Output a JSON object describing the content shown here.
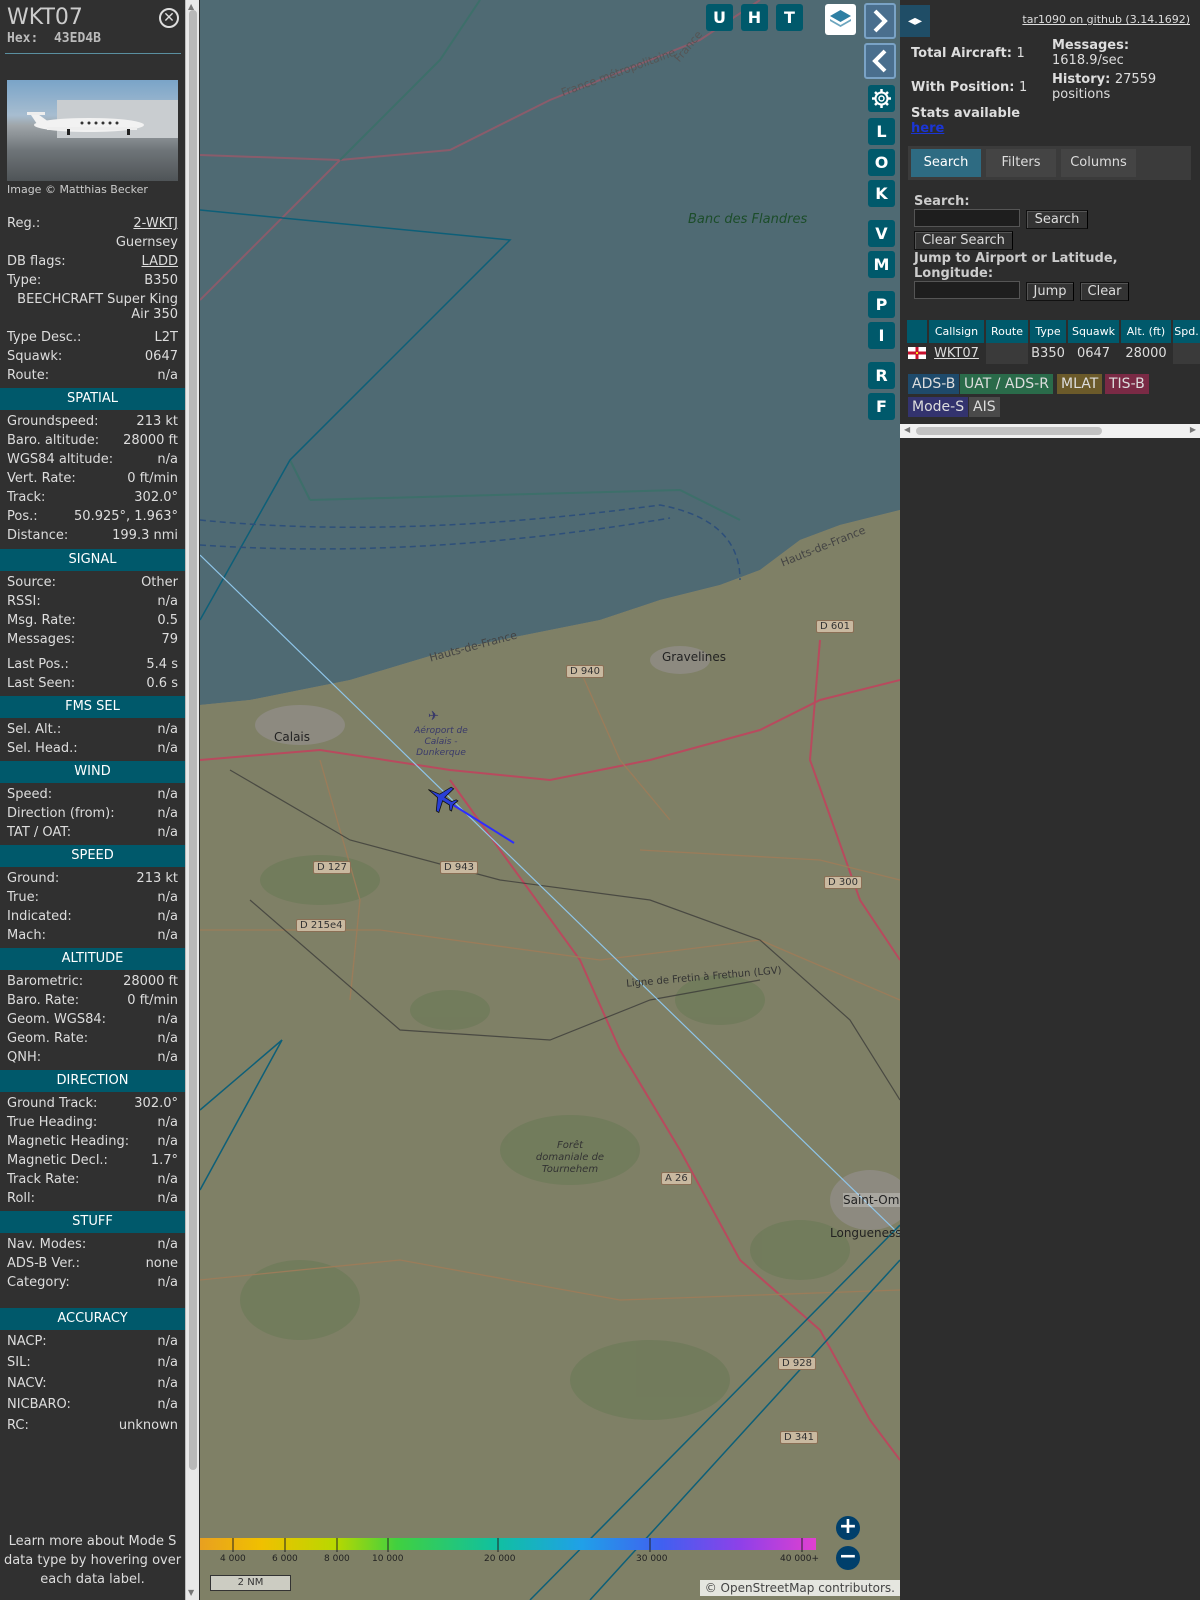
{
  "aircraft": {
    "callsign": "WKT07",
    "hex_label": "Hex:",
    "hex": "43ED4B",
    "image_credit": "Image © Matthias Becker"
  },
  "details": [
    {
      "k": "Reg.:",
      "v": "2-WKTJ",
      "underline": true
    },
    {
      "k": "",
      "v": "Guernsey"
    },
    {
      "k": "DB flags:",
      "v": "LADD",
      "underline": true
    },
    {
      "k": "Type:",
      "v": "B350"
    }
  ],
  "type_full": "BEECHCRAFT Super King Air 350",
  "details2": [
    {
      "k": "Type Desc.:",
      "v": "L2T"
    },
    {
      "k": "Squawk:",
      "v": "0647"
    },
    {
      "k": "Route:",
      "v": "n/a"
    }
  ],
  "sections": [
    {
      "title": "SPATIAL",
      "rows": [
        {
          "k": "Groundspeed:",
          "v": "213 kt"
        },
        {
          "k": "Baro. altitude:",
          "v": "28000 ft"
        },
        {
          "k": "WGS84 altitude:",
          "v": "n/a"
        },
        {
          "k": "Vert. Rate:",
          "v": "0 ft/min"
        },
        {
          "k": "Track:",
          "v": "302.0°"
        },
        {
          "k": "Pos.:",
          "v": "50.925°, 1.963°"
        },
        {
          "k": "Distance:",
          "v": "199.3 nmi"
        }
      ]
    },
    {
      "title": "SIGNAL",
      "rows": [
        {
          "k": "Source:",
          "v": "Other"
        },
        {
          "k": "RSSI:",
          "v": "n/a"
        },
        {
          "k": "Msg. Rate:",
          "v": "0.5"
        },
        {
          "k": "Messages:",
          "v": "79"
        },
        {
          "k": "Last Pos.:",
          "v": "5.4 s"
        },
        {
          "k": "Last Seen:",
          "v": "0.6 s"
        }
      ]
    },
    {
      "title": "FMS SEL",
      "rows": [
        {
          "k": "Sel. Alt.:",
          "v": "n/a"
        },
        {
          "k": "Sel. Head.:",
          "v": "n/a"
        }
      ]
    },
    {
      "title": "WIND",
      "rows": [
        {
          "k": "Speed:",
          "v": "n/a"
        },
        {
          "k": "Direction (from):",
          "v": "n/a"
        },
        {
          "k": "TAT / OAT:",
          "v": "n/a"
        }
      ]
    },
    {
      "title": "SPEED",
      "rows": [
        {
          "k": "Ground:",
          "v": "213 kt"
        },
        {
          "k": "True:",
          "v": "n/a"
        },
        {
          "k": "Indicated:",
          "v": "n/a"
        },
        {
          "k": "Mach:",
          "v": "n/a"
        }
      ]
    },
    {
      "title": "ALTITUDE",
      "rows": [
        {
          "k": "Barometric:",
          "v": "28000 ft"
        },
        {
          "k": "Baro. Rate:",
          "v": "0 ft/min"
        },
        {
          "k": "Geom. WGS84:",
          "v": "n/a"
        },
        {
          "k": "Geom. Rate:",
          "v": "n/a"
        },
        {
          "k": "QNH:",
          "v": "n/a"
        }
      ]
    },
    {
      "title": "DIRECTION",
      "rows": [
        {
          "k": "Ground Track:",
          "v": "302.0°"
        },
        {
          "k": "True Heading:",
          "v": "n/a"
        },
        {
          "k": "Magnetic Heading:",
          "v": "n/a"
        },
        {
          "k": "Magnetic Decl.:",
          "v": "1.7°"
        },
        {
          "k": "Track Rate:",
          "v": "n/a"
        },
        {
          "k": "Roll:",
          "v": "n/a"
        }
      ]
    },
    {
      "title": "STUFF",
      "rows": [
        {
          "k": "Nav. Modes:",
          "v": "n/a"
        },
        {
          "k": "ADS-B Ver.:",
          "v": "none"
        },
        {
          "k": "Category:",
          "v": "n/a"
        }
      ]
    },
    {
      "title": "ACCURACY",
      "rows": [
        {
          "k": "NACP:",
          "v": "n/a"
        },
        {
          "k": "SIL:",
          "v": "n/a"
        },
        {
          "k": "NACV:",
          "v": "n/a"
        },
        {
          "k": "NICBARO:",
          "v": "n/a"
        },
        {
          "k": "RC:",
          "v": "unknown"
        }
      ]
    }
  ],
  "learn_more": "Learn more about Mode S data type by hovering over each data label.",
  "map": {
    "top_buttons": [
      "U",
      "H",
      "T"
    ],
    "side_buttons": [
      "L",
      "O",
      "K",
      "V",
      "M",
      "P",
      "I",
      "R",
      "F"
    ],
    "settings_icon": "gear-icon",
    "layers_icon": "layers-icon",
    "labels": {
      "banc": "Banc des Flandres",
      "gravelines": "Gravelines",
      "calais": "Calais",
      "aeroport": "Aéroport de Calais - Dunkerque",
      "france_metro": "France métropolitaine",
      "france": "France",
      "hauts1": "Hauts-de-France",
      "hauts2": "Hauts-de-France",
      "saint_omer": "Saint-Omer",
      "longuenesse": "Longuenesse",
      "foret": "Forêt domaniale de Tournehem",
      "ligne": "Ligne de Fretin à Frethun (LGV)"
    },
    "road_tags": [
      "D 940",
      "D 601",
      "D 127",
      "D 943",
      "D 300",
      "D 215e4",
      "A 26",
      "D 928",
      "D 341"
    ],
    "colorbar_labels": [
      "4 000",
      "6 000",
      "8 000",
      "10 000",
      "20 000",
      "30 000",
      "40 000+"
    ],
    "scale": "2 NM",
    "attribution": "© OpenStreetMap contributors."
  },
  "right": {
    "github": "tar1090 on github (3.14.1692)",
    "total_aircraft_label": "Total Aircraft:",
    "total_aircraft": "1",
    "with_position_label": "With Position:",
    "with_position": "1",
    "messages_label": "Messages:",
    "messages_value": "1618.9/sec",
    "history_label": "History:",
    "history_value": "27559",
    "history_unit": "positions",
    "stats_label": "Stats available",
    "stats_link": "here",
    "tabs": [
      "Search",
      "Filters",
      "Columns"
    ],
    "search_label": "Search:",
    "search_button": "Search",
    "clear_search_button": "Clear Search",
    "jump_label": "Jump to Airport or Latitude, Longitude:",
    "jump_button": "Jump",
    "clear_button": "Clear",
    "table_headers": [
      "Callsign",
      "Route",
      "Type",
      "Squawk",
      "Alt. (ft)",
      "Spd."
    ],
    "table_row": {
      "callsign": "WKT07",
      "route": "",
      "type": "B350",
      "squawk": "0647",
      "alt": "28000",
      "spd": ""
    },
    "sources": [
      {
        "label": "ADS-B",
        "color": "#1e4a6b"
      },
      {
        "label": "UAT / ADS-R",
        "color": "#2a6b4a"
      },
      {
        "label": "MLAT",
        "color": "#6b5a2a"
      },
      {
        "label": "TIS-B",
        "color": "#7a2a45"
      },
      {
        "label": "Mode-S",
        "color": "#33336e"
      },
      {
        "label": "AIS",
        "color": "#4a4a4a"
      }
    ]
  }
}
